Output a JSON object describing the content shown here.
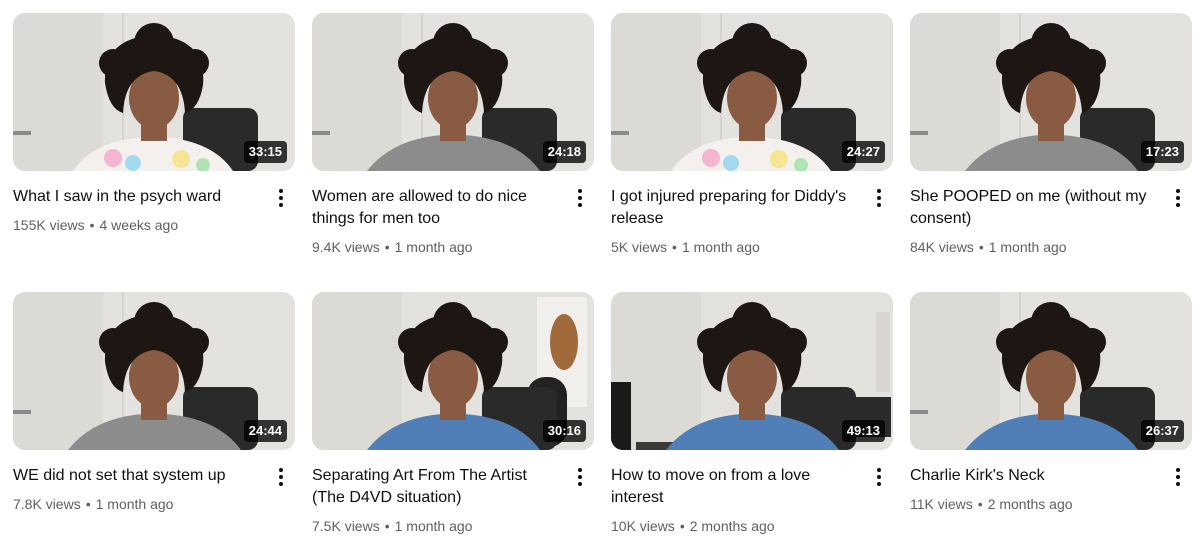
{
  "videos": [
    {
      "title": "What I saw in the psych ward",
      "duration": "33:15",
      "views": "155K views",
      "age": "4 weeks ago",
      "scene": "tiedye"
    },
    {
      "title": "Women are allowed to do nice things for men too",
      "duration": "24:18",
      "views": "9.4K views",
      "age": "1 month ago",
      "scene": "grey"
    },
    {
      "title": "I got injured preparing for Diddy's release",
      "duration": "24:27",
      "views": "5K views",
      "age": "1 month ago",
      "scene": "tiedye"
    },
    {
      "title": "She POOPED on me (without my consent)",
      "duration": "17:23",
      "views": "84K views",
      "age": "1 month ago",
      "scene": "grey"
    },
    {
      "title": "WE did not set that system up",
      "duration": "24:44",
      "views": "7.8K views",
      "age": "1 month ago",
      "scene": "grey"
    },
    {
      "title": "Separating Art From The Artist (The D4VD situation)",
      "duration": "30:16",
      "views": "7.5K views",
      "age": "1 month ago",
      "scene": "blue-studio"
    },
    {
      "title": "How to move on from a love interest",
      "duration": "49:13",
      "views": "10K views",
      "age": "2 months ago",
      "scene": "blue-desk"
    },
    {
      "title": "Charlie Kirk's Neck",
      "duration": "26:37",
      "views": "11K views",
      "age": "2 months ago",
      "scene": "blue-plain"
    }
  ],
  "colors": {
    "wall": "#e4e2de",
    "hair": "#1d1612",
    "skin": "#8a5b43",
    "chair": "#2a2a2a",
    "grey_shirt": "#8c8c8c",
    "blue_shirt": "#4f7fb6",
    "duration_bg": "#000000",
    "meta_text": "#606060"
  }
}
